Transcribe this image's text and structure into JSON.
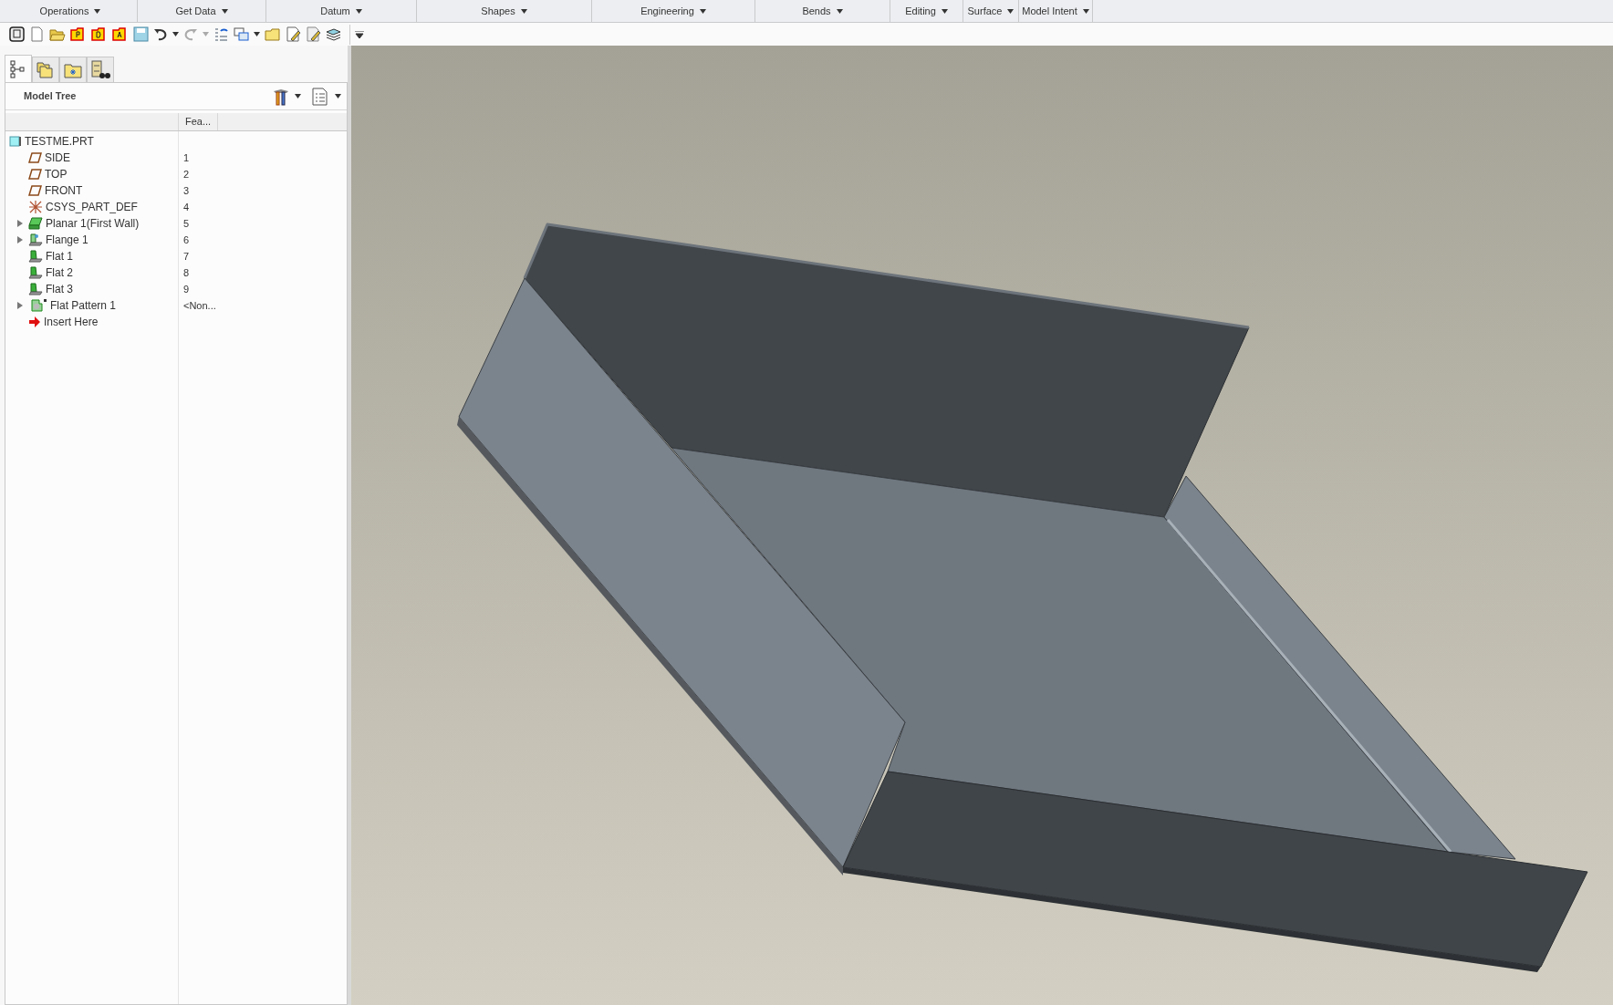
{
  "menu_bar": [
    {
      "label": "Operations"
    },
    {
      "label": "Get Data"
    },
    {
      "label": "Datum"
    },
    {
      "label": "Shapes"
    },
    {
      "label": "Engineering"
    },
    {
      "label": "Bends"
    },
    {
      "label": "Editing"
    },
    {
      "label": "Surface"
    },
    {
      "label": "Model Intent"
    }
  ],
  "panel_tabs": [
    {
      "kind": "tree",
      "selected": true
    },
    {
      "kind": "folders",
      "selected": false
    },
    {
      "kind": "favorites",
      "selected": false
    },
    {
      "kind": "search",
      "selected": false
    }
  ],
  "model_tree": {
    "title": "Model Tree",
    "columns": [
      "Fea..."
    ],
    "root": {
      "label": "TESTME.PRT",
      "kind": "part",
      "children": [
        {
          "label": "SIDE",
          "kind": "datum",
          "feature": "1"
        },
        {
          "label": "TOP",
          "kind": "datum",
          "feature": "2"
        },
        {
          "label": "FRONT",
          "kind": "datum",
          "feature": "3"
        },
        {
          "label": "CSYS_PART_DEF",
          "kind": "csys",
          "feature": "4"
        },
        {
          "label": "Planar 1(First Wall)",
          "kind": "wall",
          "feature": "5",
          "expanded": false
        },
        {
          "label": "Flange 1",
          "kind": "flange",
          "feature": "6",
          "expanded": false
        },
        {
          "label": "Flat 1",
          "kind": "flat",
          "feature": "7"
        },
        {
          "label": "Flat 2",
          "kind": "flat",
          "feature": "8"
        },
        {
          "label": "Flat 3",
          "kind": "flat",
          "feature": "9"
        },
        {
          "label": "Flat Pattern 1",
          "kind": "pattern",
          "feature": "<Non...",
          "expanded": false
        },
        {
          "label": "Insert Here",
          "kind": "insert"
        }
      ]
    }
  }
}
